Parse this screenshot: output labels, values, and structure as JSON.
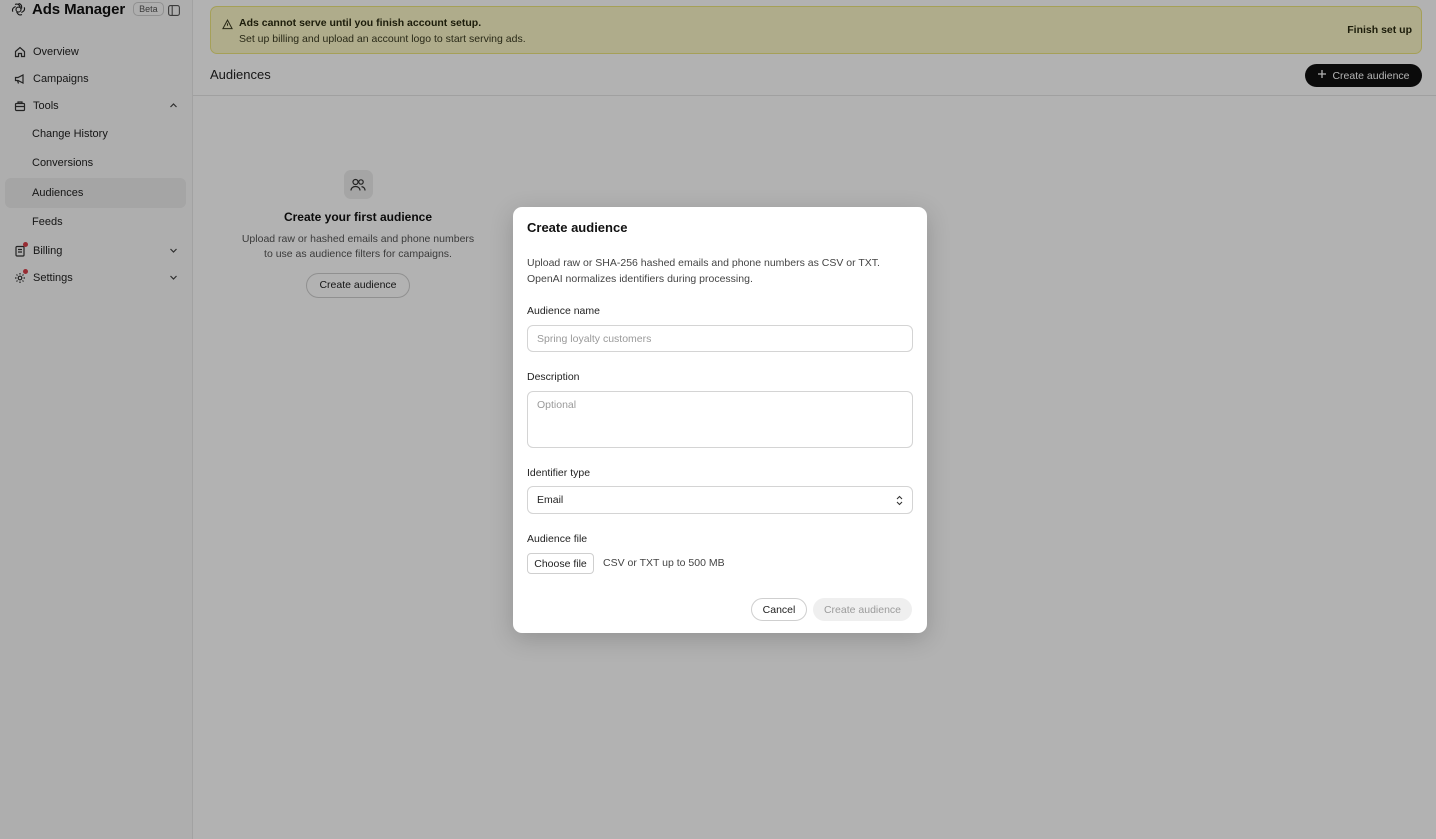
{
  "sidebar": {
    "brand": {
      "title": "Ads Manager",
      "badge": "Beta"
    },
    "items": [
      {
        "label": "Overview",
        "icon": "home-icon"
      },
      {
        "label": "Campaigns",
        "icon": "megaphone-icon"
      },
      {
        "label": "Tools",
        "icon": "toolbox-icon",
        "expanded": true
      }
    ],
    "sub_items": [
      {
        "label": "Change History"
      },
      {
        "label": "Conversions"
      },
      {
        "label": "Audiences",
        "active": true
      },
      {
        "label": "Feeds"
      }
    ],
    "bottom_items": [
      {
        "label": "Billing",
        "icon": "billing-icon",
        "notification": true
      },
      {
        "label": "Settings",
        "icon": "gear-icon",
        "notification": true
      }
    ]
  },
  "banner": {
    "title": "Ads cannot serve until you finish account setup.",
    "text": "Set up billing and upload an account logo to start serving ads.",
    "action": "Finish set up",
    "icon": "warning-icon"
  },
  "header": {
    "title": "Audiences",
    "create_button": "Create audience"
  },
  "empty_state": {
    "icon": "users-icon",
    "title": "Create your first audience",
    "description": "Upload raw or hashed emails and phone numbers to use as audience filters for campaigns.",
    "button": "Create audience"
  },
  "modal": {
    "title": "Create audience",
    "description": "Upload raw or SHA-256 hashed emails and phone numbers as CSV or TXT. OpenAI normalizes identifiers during processing.",
    "name_label": "Audience name",
    "name_placeholder": "Spring loyalty customers",
    "name_value": "",
    "description_label": "Description",
    "description_placeholder": "Optional",
    "description_value": "",
    "identifier_label": "Identifier type",
    "identifier_value": "Email",
    "file_label": "Audience file",
    "file_button": "Choose file",
    "file_hint": "CSV or TXT up to 500 MB",
    "cancel": "Cancel",
    "submit": "Create audience"
  },
  "colors": {
    "banner_bg": "#fbf7c8",
    "banner_border": "#ece57f",
    "primary_button": "#111111",
    "notification_dot": "#d9404a",
    "overlay": "rgba(0,0,0,0.30)"
  }
}
